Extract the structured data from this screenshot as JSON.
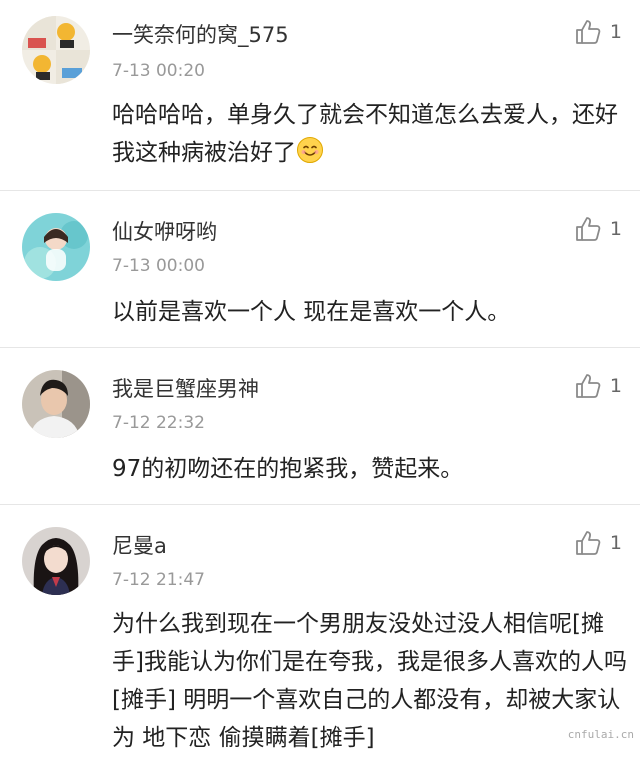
{
  "comments": [
    {
      "username": "一笑奈何的窝_575",
      "time": "7-13 00:20",
      "likes": "1",
      "content": "哈哈哈哈，单身久了就会不知道怎么去爱人，还好我这种病被治好了",
      "emoji": "smile-emoji"
    },
    {
      "username": "仙女咿呀哟",
      "time": "7-13 00:00",
      "likes": "1",
      "content": "以前是喜欢一个人 现在是喜欢一个人。"
    },
    {
      "username": "我是巨蟹座男神",
      "time": "7-12 22:32",
      "likes": "1",
      "content": "97的初吻还在的抱紧我，赞起来。"
    },
    {
      "username": "尼曼a",
      "time": "7-12 21:47",
      "likes": "1",
      "content": "为什么我到现在一个男朋友没处过没人相信呢[摊手]我能认为你们是在夸我，我是很多人喜欢的人吗[摊手] 明明一个喜欢自己的人都没有，却被大家认为 地下恋 偷摸瞒着[摊手]"
    }
  ],
  "watermark": "cnfulai.cn",
  "icons": {
    "like": "thumbs-up-icon"
  },
  "colors": {
    "text": "#222222",
    "meta": "#999999",
    "divider": "#e6e6e6"
  }
}
